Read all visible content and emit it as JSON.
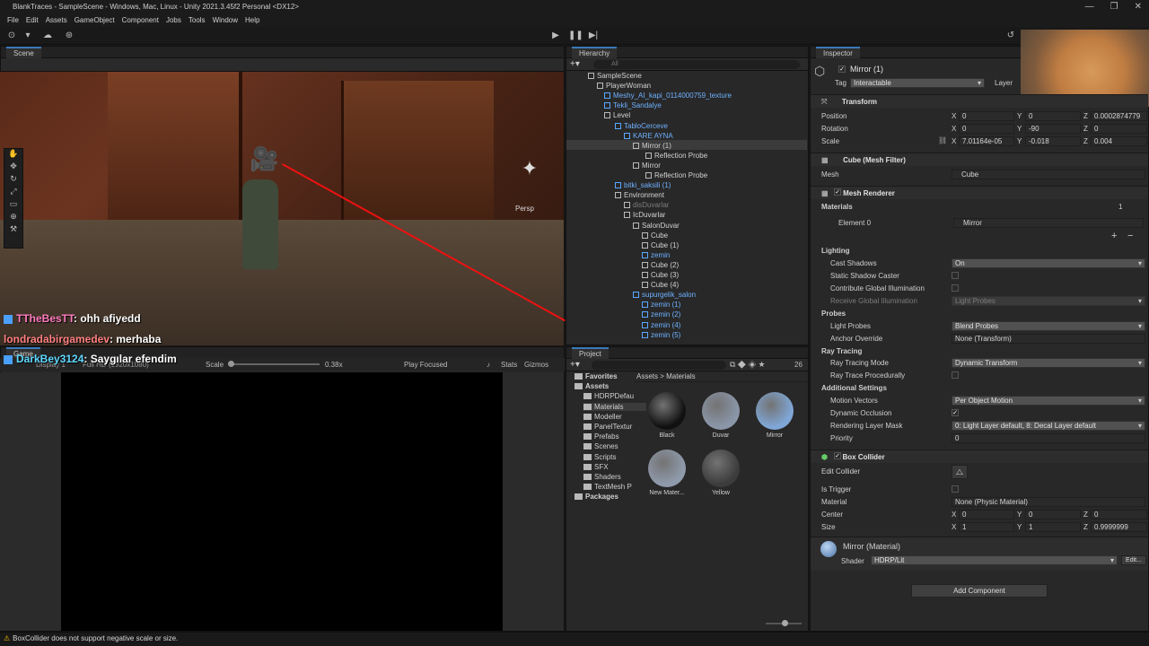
{
  "window": {
    "title": "BlankTraces - SampleScene - Windows, Mac, Linux - Unity 2021.3.45f2 Personal <DX12>"
  },
  "menu": [
    "File",
    "Edit",
    "Assets",
    "GameObject",
    "Component",
    "Jobs",
    "Tools",
    "Window",
    "Help"
  ],
  "scene": {
    "tab": "Scene",
    "persp_label": "Persp",
    "chat": [
      {
        "user": "TTheBesTT",
        "message": ": ohh afiyedd"
      },
      {
        "user": "londradabirgamedev",
        "message": ": merhaba"
      },
      {
        "user": "DarkBey3124",
        "message": ": Saygılar efendim"
      }
    ]
  },
  "game": {
    "tab": "Game",
    "display": "Display 1",
    "resolution": "Full HD (1920x1080)",
    "scale_label": "Scale",
    "scale_value": "0.38x",
    "play_mode": "Play Focused",
    "stats": "Stats",
    "gizmos": "Gizmos"
  },
  "hierarchy": {
    "tab": "Hierarchy",
    "search_placeholder": "All",
    "items": [
      {
        "label": "SampleScene",
        "style": "normal"
      },
      {
        "label": "PlayerWoman",
        "style": "normal"
      },
      {
        "label": "Meshy_AI_kapi_0114000759_texture",
        "style": "blue"
      },
      {
        "label": "Tekli_Sandalye",
        "style": "blue"
      },
      {
        "label": "Level",
        "style": "normal"
      },
      {
        "label": "TabloCerceve",
        "style": "blue"
      },
      {
        "label": "KARE AYNA",
        "style": "blue"
      },
      {
        "label": "Mirror (1)",
        "style": "normal"
      },
      {
        "label": "Reflection Probe",
        "style": "normal"
      },
      {
        "label": "Mirror",
        "style": "normal"
      },
      {
        "label": "Reflection Probe",
        "style": "normal"
      },
      {
        "label": "bitki_saksili (1)",
        "style": "blue"
      },
      {
        "label": "Environment",
        "style": "normal"
      },
      {
        "label": "disDuvarlar",
        "style": "dim"
      },
      {
        "label": "IcDuvarlar",
        "style": "normal"
      },
      {
        "label": "SalonDuvar",
        "style": "normal"
      },
      {
        "label": "Cube",
        "style": "normal"
      },
      {
        "label": "Cube (1)",
        "style": "normal"
      },
      {
        "label": "zemin",
        "style": "blue"
      },
      {
        "label": "Cube (2)",
        "style": "normal"
      },
      {
        "label": "Cube (3)",
        "style": "normal"
      },
      {
        "label": "Cube (4)",
        "style": "normal"
      },
      {
        "label": "supurgelik_salon",
        "style": "blue"
      },
      {
        "label": "zemin (1)",
        "style": "blue"
      },
      {
        "label": "zemin (2)",
        "style": "blue"
      },
      {
        "label": "zemin (4)",
        "style": "blue"
      },
      {
        "label": "zemin (5)",
        "style": "blue"
      }
    ]
  },
  "project": {
    "tab": "Project",
    "count": "26",
    "breadcrumb": [
      "Assets",
      "Materials"
    ],
    "tree": [
      "Favorites",
      "Assets",
      "HDRPDefau",
      "Materials",
      "Modeller",
      "PanelTextur",
      "Prefabs",
      "Scenes",
      "Scripts",
      "SFX",
      "Shaders",
      "TextMesh P",
      "Packages"
    ],
    "materials": [
      {
        "name": "Black",
        "color": "#111111"
      },
      {
        "name": "Duvar",
        "color": "#8a96a8"
      },
      {
        "name": "Mirror",
        "color": "#7fa6d6"
      },
      {
        "name": "New Mater...",
        "color": "#8f9aab"
      },
      {
        "name": "Yellow",
        "color": "#3c3c3c"
      }
    ]
  },
  "inspector": {
    "tab": "Inspector",
    "object_name": "Mirror (1)",
    "tag_label": "Tag",
    "tag_value": "Interactable",
    "layer_label": "Layer",
    "transform": {
      "title": "Transform",
      "position": {
        "label": "Position",
        "x": "0",
        "y": "0",
        "z": "0.0002874779"
      },
      "rotation": {
        "label": "Rotation",
        "x": "0",
        "y": "-90",
        "z": "0"
      },
      "scale": {
        "label": "Scale",
        "x": "7.01164e-05",
        "y": "-0.018",
        "z": "0.004"
      }
    },
    "mesh_filter": {
      "title": "Cube (Mesh Filter)",
      "mesh_label": "Mesh",
      "mesh_value": "Cube"
    },
    "mesh_renderer": {
      "title": "Mesh Renderer",
      "materials_label": "Materials",
      "materials_count": "1",
      "element_label": "Element 0",
      "element_value": "Mirror",
      "lighting": "Lighting",
      "cast_shadows_label": "Cast Shadows",
      "cast_shadows_value": "On",
      "static_shadow_label": "Static Shadow Caster",
      "contribute_gi_label": "Contribute Global Illumination",
      "receive_gi_label": "Receive Global Illumination",
      "receive_gi_value": "Light Probes",
      "probes": "Probes",
      "light_probes_label": "Light Probes",
      "light_probes_value": "Blend Probes",
      "anchor_label": "Anchor Override",
      "anchor_value": "None (Transform)",
      "ray_tracing": "Ray Tracing",
      "ray_mode_label": "Ray Tracing Mode",
      "ray_mode_value": "Dynamic Transform",
      "ray_proc_label": "Ray Trace Procedurally",
      "additional": "Additional Settings",
      "motion_label": "Motion Vectors",
      "motion_value": "Per Object Motion",
      "occlusion_label": "Dynamic Occlusion",
      "layer_mask_label": "Rendering Layer Mask",
      "layer_mask_value": "0: Light Layer default, 8: Decal Layer default",
      "priority_label": "Priority",
      "priority_value": "0"
    },
    "box_collider": {
      "title": "Box Collider",
      "edit_label": "Edit Collider",
      "trigger_label": "Is Trigger",
      "material_label": "Material",
      "material_value": "None (Physic Material)",
      "center_label": "Center",
      "center": {
        "x": "0",
        "y": "0",
        "z": "0"
      },
      "size_label": "Size",
      "size": {
        "x": "1",
        "y": "1",
        "z": "0.9999999"
      }
    },
    "material": {
      "title": "Mirror (Material)",
      "shader_label": "Shader",
      "shader_value": "HDRP/Lit",
      "edit_button": "Edit..."
    },
    "add_component": "Add Component"
  },
  "status": {
    "message": "BoxCollider does not support negative scale or size."
  }
}
